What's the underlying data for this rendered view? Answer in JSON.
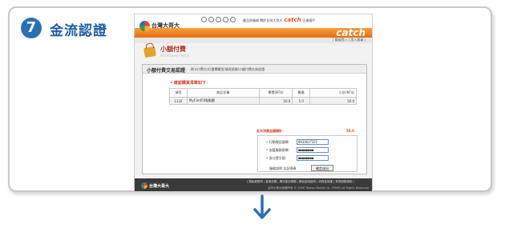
{
  "step": {
    "number": "7",
    "title": "金流認證"
  },
  "site": {
    "logo_text": "台灣大哥大",
    "top_links": "產品與服務  關於台灣大哥大",
    "catch_text": "catch",
    "top_link_end": "企業客戶",
    "catch_logo": "catch",
    "sub_links": "| 會員登入 | 加入會員 |"
  },
  "page": {
    "title": "小額付費",
    "subtitle": "Micropayment"
  },
  "panel": {
    "title": "小額付費交易認證",
    "breadcrumb": "刷卡付費方式/選擇類型/填寫個資/小額付費交易認證",
    "confirm_label": "• 確認購買清單如下：",
    "table": {
      "headers": [
        "項目",
        "商品名稱",
        "單價(NT$)",
        "數量",
        "小計(NT$)"
      ],
      "rows": [
        [
          "1132",
          "MyCard50點點數",
          "50.0",
          "1.0",
          "50.0"
        ]
      ]
    },
    "total_label": "此次消費金額總計：",
    "total_value": "50.0"
  },
  "form": {
    "phone_label": "• 行動電話號碼：",
    "phone_value": "0933617321",
    "pin_label": "• 加值服務密碼：",
    "pin_value": "●●●●●●●●",
    "id_label": "• 身分證字號：",
    "id_value": "●●●●●●●●",
    "links": "服務說明  忘記密碼",
    "submit_label": "確定送出"
  },
  "footer": {
    "logo_text": "台灣大哥大",
    "links": "| 隱私權聲明 | 客服信箱 | 網站使用規範 | 網站使用說明 | 消費者保護 | 會員服務條款 |",
    "copyright": "台灣大哥大版權所有 © 2008 Taiwan Mobile Co. (TWM) All Rights Reserved."
  },
  "colors": {
    "accent_blue": "#1d5fa8",
    "brand_orange": "#e46b13",
    "alert_red": "#d2432a"
  }
}
